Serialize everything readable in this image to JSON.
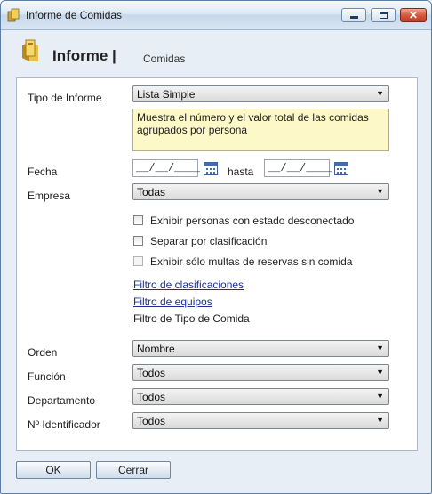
{
  "window": {
    "title": "Informe de Comidas"
  },
  "header": {
    "title": "Informe |",
    "subtitle": "Comidas"
  },
  "form": {
    "tipo_label": "Tipo de Informe",
    "tipo_value": "Lista Simple",
    "description": "Muestra el número y el valor total de las comidas agrupados por persona",
    "fecha_label": "Fecha",
    "fecha_from": "__/__/____",
    "fecha_to": "__/__/____",
    "hasta_label": "hasta",
    "empresa_label": "Empresa",
    "empresa_value": "Todas",
    "checkboxes": [
      {
        "label": "Exhibir personas con estado desconectado",
        "checked": false,
        "enabled": true
      },
      {
        "label": "Separar por clasificación",
        "checked": false,
        "enabled": true
      },
      {
        "label": "Exhibir sólo multas de reservas sin comida",
        "checked": false,
        "enabled": false
      }
    ],
    "links": [
      "Filtro de clasificaciones",
      "Filtro de equipos"
    ],
    "static_filter": "Filtro de Tipo de Comida",
    "orden_label": "Orden",
    "orden_value": "Nombre",
    "funcion_label": "Función",
    "funcion_value": "Todos",
    "departamento_label": "Departamento",
    "departamento_value": "Todos",
    "identificador_label": "Nº Identificador",
    "identificador_value": "Todos"
  },
  "buttons": {
    "ok": "OK",
    "cerrar": "Cerrar"
  },
  "icons": {
    "window": "report-icon",
    "header": "report-icon",
    "calendar": "calendar-icon",
    "dropdown": "chevron-down-icon"
  }
}
